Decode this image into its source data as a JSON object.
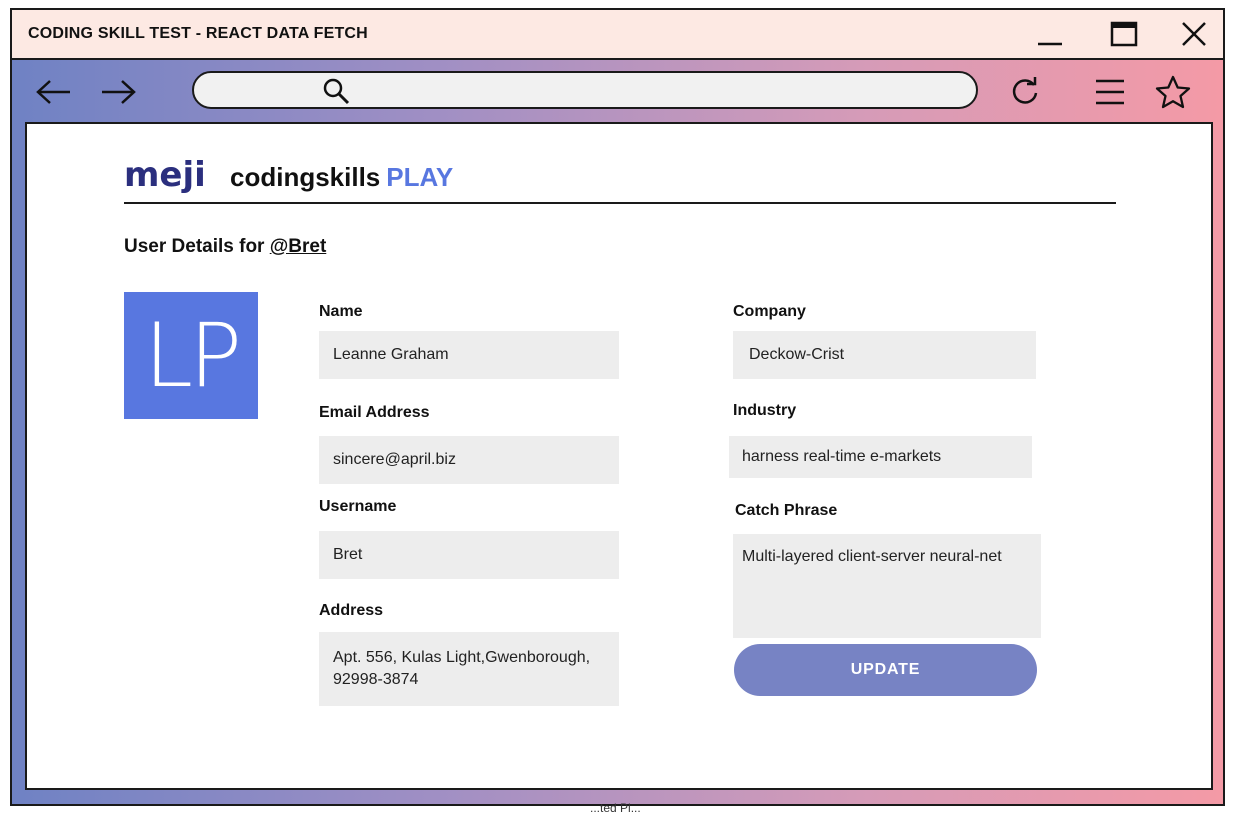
{
  "window": {
    "title": "CODING SKILL TEST -  REACT DATA FETCH",
    "controls": [
      "minimize-icon",
      "maximize-icon",
      "close-icon"
    ]
  },
  "toolbar": {
    "icons": [
      "back-arrow-icon",
      "forward-arrow-icon",
      "search-icon",
      "reload-icon",
      "menu-icon",
      "star-icon"
    ],
    "address_value": ""
  },
  "brand": {
    "logo_text": "meji",
    "name": "codingskills",
    "play": "PLAY",
    "accent": "#5877e0"
  },
  "page": {
    "heading_prefix": "User Details for",
    "username_handle": "@Bret"
  },
  "avatar": {
    "initials": "LP",
    "color": "#5877e0"
  },
  "form": {
    "name": {
      "label": "Name",
      "value": "Leanne Graham"
    },
    "email": {
      "label": "Email Address",
      "value": "sincere@april.biz"
    },
    "username": {
      "label": "Username",
      "value": "Bret"
    },
    "address": {
      "label": "Address",
      "value": "Apt. 556, Kulas Light,Gwenborough, 92998-3874"
    },
    "company": {
      "label": "Company",
      "value": "Deckow-Crist"
    },
    "industry": {
      "label": "Industry",
      "value": "harness real-time e-markets"
    },
    "catch_phrase": {
      "label": "Catch Phrase",
      "value": "Multi-layered client-server neural-net"
    }
  },
  "actions": {
    "update_label": "UPDATE",
    "update_color": "#7783c4"
  },
  "footer": {
    "partial_text": "...ted Pl..."
  }
}
